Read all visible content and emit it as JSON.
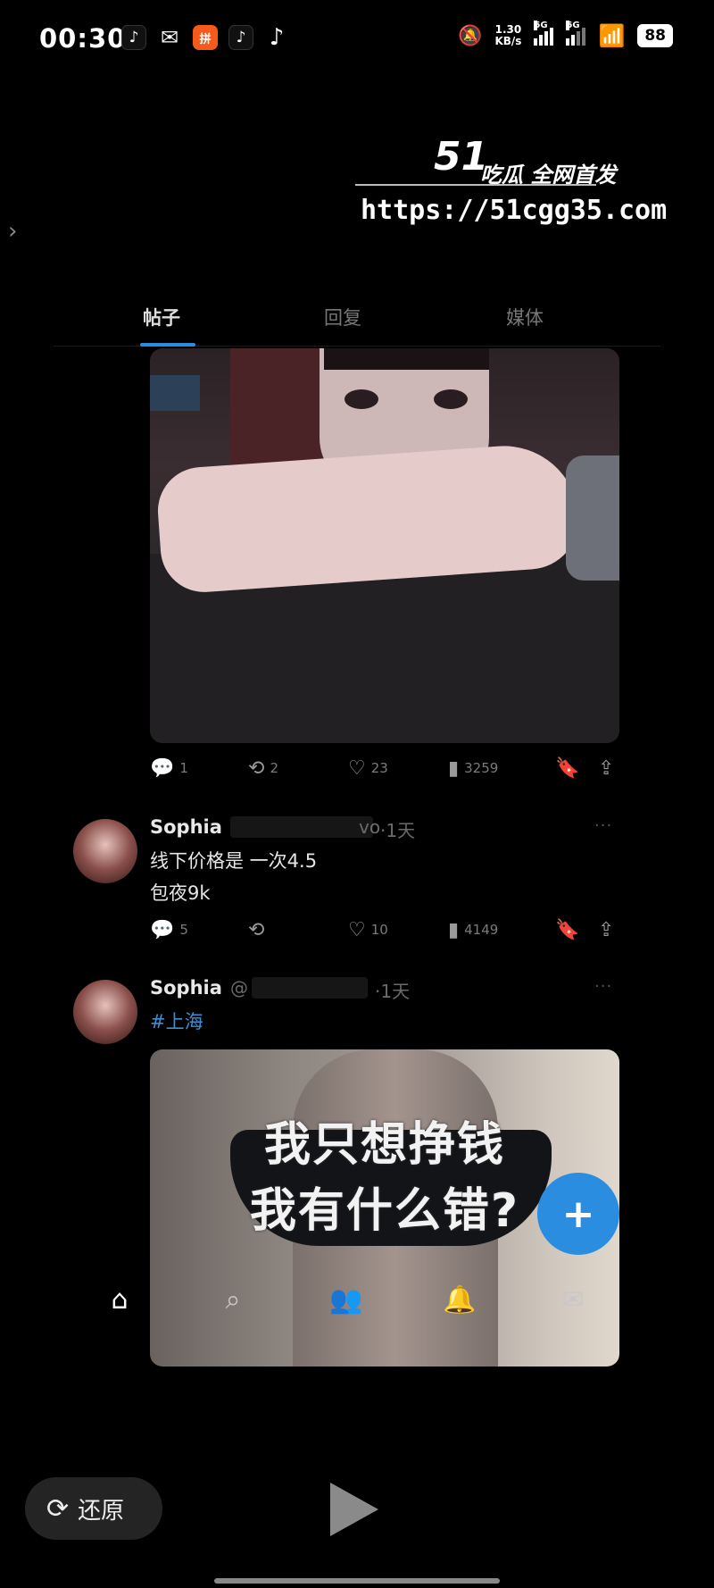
{
  "status_bar": {
    "time": "00:30",
    "app_icons": [
      {
        "icon": "tiktok-icon",
        "glyph": "♪"
      },
      {
        "icon": "wechat-icon",
        "glyph": "✉"
      },
      {
        "icon": "shopping-app-icon",
        "glyph": "拼"
      },
      {
        "icon": "tiktok-icon",
        "glyph": "♪"
      },
      {
        "icon": "tiktok-icon",
        "glyph": "♪"
      }
    ],
    "speed_value": "1.30",
    "speed_unit": "KB/s",
    "signal1_label": "5G",
    "signal2_label": "5G",
    "battery": "88"
  },
  "watermark": {
    "logo": "51",
    "slogan": "吃瓜 全网首发",
    "url": "https://51cgg35.com"
  },
  "tabs": [
    {
      "label": "帖子",
      "active": true
    },
    {
      "label": "回复",
      "active": false
    },
    {
      "label": "媒体",
      "active": false
    }
  ],
  "post1": {
    "stats": {
      "replies": "1",
      "reposts": "2",
      "likes": "23",
      "views": "3259"
    }
  },
  "post2": {
    "author": "Sophia",
    "handle_tail": "vo",
    "time": "·1天",
    "text_line1": "线下价格是 一次4.5",
    "text_line2": "包夜9k",
    "stats": {
      "replies": "5",
      "reposts": "",
      "likes": "10",
      "views": "4149"
    }
  },
  "post3": {
    "author": "Sophia",
    "handle": "@",
    "time": "·1天",
    "hashtag": "#上海",
    "image_caption_line1": "我只想挣钱",
    "image_caption_line2": "我有什么错?"
  },
  "fab": {
    "icon": "compose-plus-icon",
    "glyph": "+"
  },
  "bottom_nav": [
    {
      "name": "home",
      "glyph": "⌂"
    },
    {
      "name": "search",
      "glyph": "⌕"
    },
    {
      "name": "communities",
      "glyph": "👥"
    },
    {
      "name": "notifications",
      "glyph": "🔔"
    },
    {
      "name": "messages",
      "glyph": "✉"
    }
  ],
  "player_controls": {
    "restore_label": "还原"
  }
}
